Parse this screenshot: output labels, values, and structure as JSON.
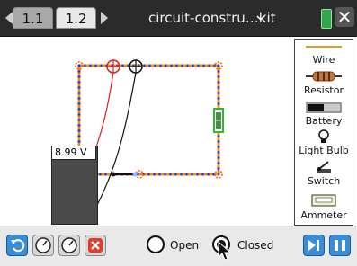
{
  "tabs": [
    {
      "label": "1.1"
    },
    {
      "label": "1.2"
    }
  ],
  "document_title": "circuit-constru…kit",
  "palette": [
    {
      "label": "Wire",
      "icon": "wire-icon"
    },
    {
      "label": "Resistor",
      "icon": "resistor-icon"
    },
    {
      "label": "Battery",
      "icon": "battery-icon"
    },
    {
      "label": "Light Bulb",
      "icon": "light-bulb-icon"
    },
    {
      "label": "Switch",
      "icon": "switch-icon"
    },
    {
      "label": "Ammeter",
      "icon": "ammeter-icon"
    }
  ],
  "voltmeter": {
    "reading": "8.99 V"
  },
  "toolbar": {
    "switch_options": [
      {
        "label": "Open",
        "selected": false
      },
      {
        "label": "Closed",
        "selected": true
      }
    ]
  },
  "colors": {
    "wire": "#1a3bdc",
    "node": "#ff8c00",
    "red_probe": "#e31b1b",
    "black_probe": "#111111",
    "battery_green": "#2eb82e"
  }
}
